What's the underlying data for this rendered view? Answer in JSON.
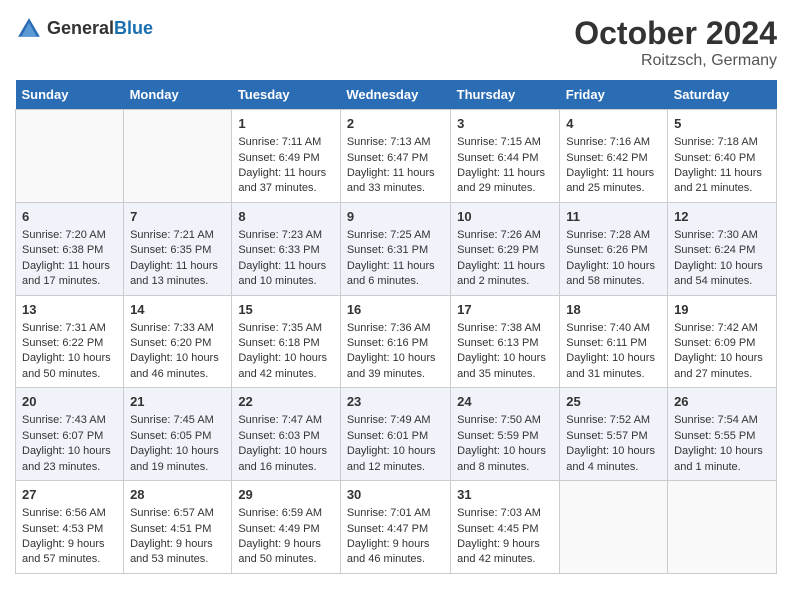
{
  "logo": {
    "general": "General",
    "blue": "Blue"
  },
  "header": {
    "month": "October 2024",
    "location": "Roitzsch, Germany"
  },
  "days_of_week": [
    "Sunday",
    "Monday",
    "Tuesday",
    "Wednesday",
    "Thursday",
    "Friday",
    "Saturday"
  ],
  "weeks": [
    [
      {
        "day": "",
        "sunrise": "",
        "sunset": "",
        "daylight": ""
      },
      {
        "day": "",
        "sunrise": "",
        "sunset": "",
        "daylight": ""
      },
      {
        "day": "1",
        "sunrise": "Sunrise: 7:11 AM",
        "sunset": "Sunset: 6:49 PM",
        "daylight": "Daylight: 11 hours and 37 minutes."
      },
      {
        "day": "2",
        "sunrise": "Sunrise: 7:13 AM",
        "sunset": "Sunset: 6:47 PM",
        "daylight": "Daylight: 11 hours and 33 minutes."
      },
      {
        "day": "3",
        "sunrise": "Sunrise: 7:15 AM",
        "sunset": "Sunset: 6:44 PM",
        "daylight": "Daylight: 11 hours and 29 minutes."
      },
      {
        "day": "4",
        "sunrise": "Sunrise: 7:16 AM",
        "sunset": "Sunset: 6:42 PM",
        "daylight": "Daylight: 11 hours and 25 minutes."
      },
      {
        "day": "5",
        "sunrise": "Sunrise: 7:18 AM",
        "sunset": "Sunset: 6:40 PM",
        "daylight": "Daylight: 11 hours and 21 minutes."
      }
    ],
    [
      {
        "day": "6",
        "sunrise": "Sunrise: 7:20 AM",
        "sunset": "Sunset: 6:38 PM",
        "daylight": "Daylight: 11 hours and 17 minutes."
      },
      {
        "day": "7",
        "sunrise": "Sunrise: 7:21 AM",
        "sunset": "Sunset: 6:35 PM",
        "daylight": "Daylight: 11 hours and 13 minutes."
      },
      {
        "day": "8",
        "sunrise": "Sunrise: 7:23 AM",
        "sunset": "Sunset: 6:33 PM",
        "daylight": "Daylight: 11 hours and 10 minutes."
      },
      {
        "day": "9",
        "sunrise": "Sunrise: 7:25 AM",
        "sunset": "Sunset: 6:31 PM",
        "daylight": "Daylight: 11 hours and 6 minutes."
      },
      {
        "day": "10",
        "sunrise": "Sunrise: 7:26 AM",
        "sunset": "Sunset: 6:29 PM",
        "daylight": "Daylight: 11 hours and 2 minutes."
      },
      {
        "day": "11",
        "sunrise": "Sunrise: 7:28 AM",
        "sunset": "Sunset: 6:26 PM",
        "daylight": "Daylight: 10 hours and 58 minutes."
      },
      {
        "day": "12",
        "sunrise": "Sunrise: 7:30 AM",
        "sunset": "Sunset: 6:24 PM",
        "daylight": "Daylight: 10 hours and 54 minutes."
      }
    ],
    [
      {
        "day": "13",
        "sunrise": "Sunrise: 7:31 AM",
        "sunset": "Sunset: 6:22 PM",
        "daylight": "Daylight: 10 hours and 50 minutes."
      },
      {
        "day": "14",
        "sunrise": "Sunrise: 7:33 AM",
        "sunset": "Sunset: 6:20 PM",
        "daylight": "Daylight: 10 hours and 46 minutes."
      },
      {
        "day": "15",
        "sunrise": "Sunrise: 7:35 AM",
        "sunset": "Sunset: 6:18 PM",
        "daylight": "Daylight: 10 hours and 42 minutes."
      },
      {
        "day": "16",
        "sunrise": "Sunrise: 7:36 AM",
        "sunset": "Sunset: 6:16 PM",
        "daylight": "Daylight: 10 hours and 39 minutes."
      },
      {
        "day": "17",
        "sunrise": "Sunrise: 7:38 AM",
        "sunset": "Sunset: 6:13 PM",
        "daylight": "Daylight: 10 hours and 35 minutes."
      },
      {
        "day": "18",
        "sunrise": "Sunrise: 7:40 AM",
        "sunset": "Sunset: 6:11 PM",
        "daylight": "Daylight: 10 hours and 31 minutes."
      },
      {
        "day": "19",
        "sunrise": "Sunrise: 7:42 AM",
        "sunset": "Sunset: 6:09 PM",
        "daylight": "Daylight: 10 hours and 27 minutes."
      }
    ],
    [
      {
        "day": "20",
        "sunrise": "Sunrise: 7:43 AM",
        "sunset": "Sunset: 6:07 PM",
        "daylight": "Daylight: 10 hours and 23 minutes."
      },
      {
        "day": "21",
        "sunrise": "Sunrise: 7:45 AM",
        "sunset": "Sunset: 6:05 PM",
        "daylight": "Daylight: 10 hours and 19 minutes."
      },
      {
        "day": "22",
        "sunrise": "Sunrise: 7:47 AM",
        "sunset": "Sunset: 6:03 PM",
        "daylight": "Daylight: 10 hours and 16 minutes."
      },
      {
        "day": "23",
        "sunrise": "Sunrise: 7:49 AM",
        "sunset": "Sunset: 6:01 PM",
        "daylight": "Daylight: 10 hours and 12 minutes."
      },
      {
        "day": "24",
        "sunrise": "Sunrise: 7:50 AM",
        "sunset": "Sunset: 5:59 PM",
        "daylight": "Daylight: 10 hours and 8 minutes."
      },
      {
        "day": "25",
        "sunrise": "Sunrise: 7:52 AM",
        "sunset": "Sunset: 5:57 PM",
        "daylight": "Daylight: 10 hours and 4 minutes."
      },
      {
        "day": "26",
        "sunrise": "Sunrise: 7:54 AM",
        "sunset": "Sunset: 5:55 PM",
        "daylight": "Daylight: 10 hours and 1 minute."
      }
    ],
    [
      {
        "day": "27",
        "sunrise": "Sunrise: 6:56 AM",
        "sunset": "Sunset: 4:53 PM",
        "daylight": "Daylight: 9 hours and 57 minutes."
      },
      {
        "day": "28",
        "sunrise": "Sunrise: 6:57 AM",
        "sunset": "Sunset: 4:51 PM",
        "daylight": "Daylight: 9 hours and 53 minutes."
      },
      {
        "day": "29",
        "sunrise": "Sunrise: 6:59 AM",
        "sunset": "Sunset: 4:49 PM",
        "daylight": "Daylight: 9 hours and 50 minutes."
      },
      {
        "day": "30",
        "sunrise": "Sunrise: 7:01 AM",
        "sunset": "Sunset: 4:47 PM",
        "daylight": "Daylight: 9 hours and 46 minutes."
      },
      {
        "day": "31",
        "sunrise": "Sunrise: 7:03 AM",
        "sunset": "Sunset: 4:45 PM",
        "daylight": "Daylight: 9 hours and 42 minutes."
      },
      {
        "day": "",
        "sunrise": "",
        "sunset": "",
        "daylight": ""
      },
      {
        "day": "",
        "sunrise": "",
        "sunset": "",
        "daylight": ""
      }
    ]
  ]
}
